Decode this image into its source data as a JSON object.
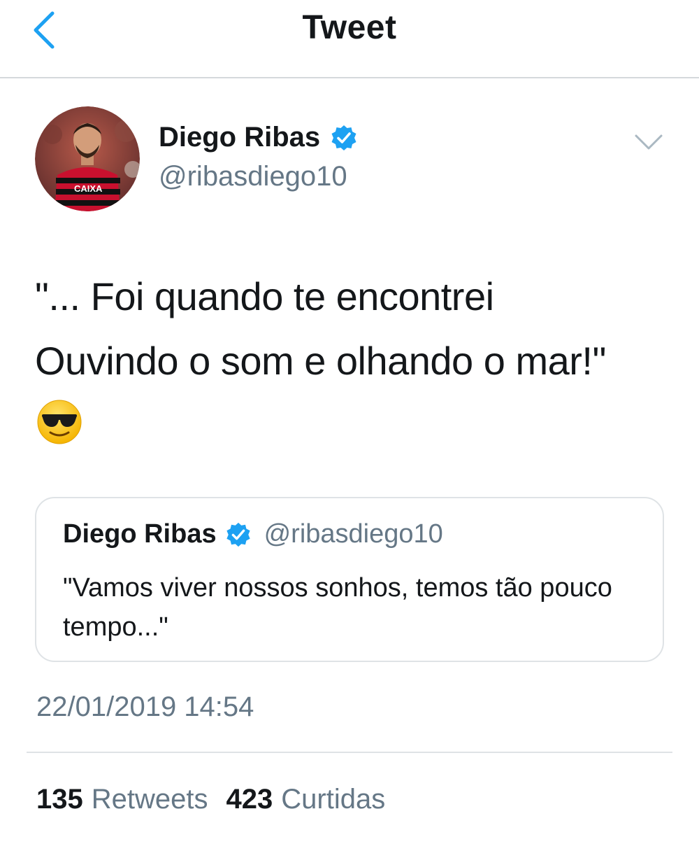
{
  "header": {
    "title": "Tweet",
    "back_icon": "chevron-left-icon",
    "accent_color": "#1da1f2"
  },
  "author": {
    "name": "Diego Ribas",
    "handle": "@ribasdiego10",
    "verified": true,
    "avatar_jersey_text": "CAIXA",
    "menu_icon": "chevron-down-icon"
  },
  "tweet": {
    "lines": [
      "\"... Foi quando te encontrei",
      "Ouvindo o som e olhando o mar!\""
    ],
    "emoji": "smiling-face-with-sunglasses"
  },
  "quoted_tweet": {
    "name": "Diego Ribas",
    "handle": "@ribasdiego10",
    "verified": true,
    "text": "\"Vamos viver nossos sonhos, temos tão pouco tempo...\""
  },
  "timestamp": "22/01/2019 14:54",
  "stats": {
    "retweets_count": "135",
    "retweets_label": "Retweets",
    "likes_count": "423",
    "likes_label": "Curtidas"
  },
  "colors": {
    "text_primary": "#14171a",
    "text_secondary": "#657786",
    "verified_blue": "#1da1f2",
    "border": "#dfe3e6"
  }
}
